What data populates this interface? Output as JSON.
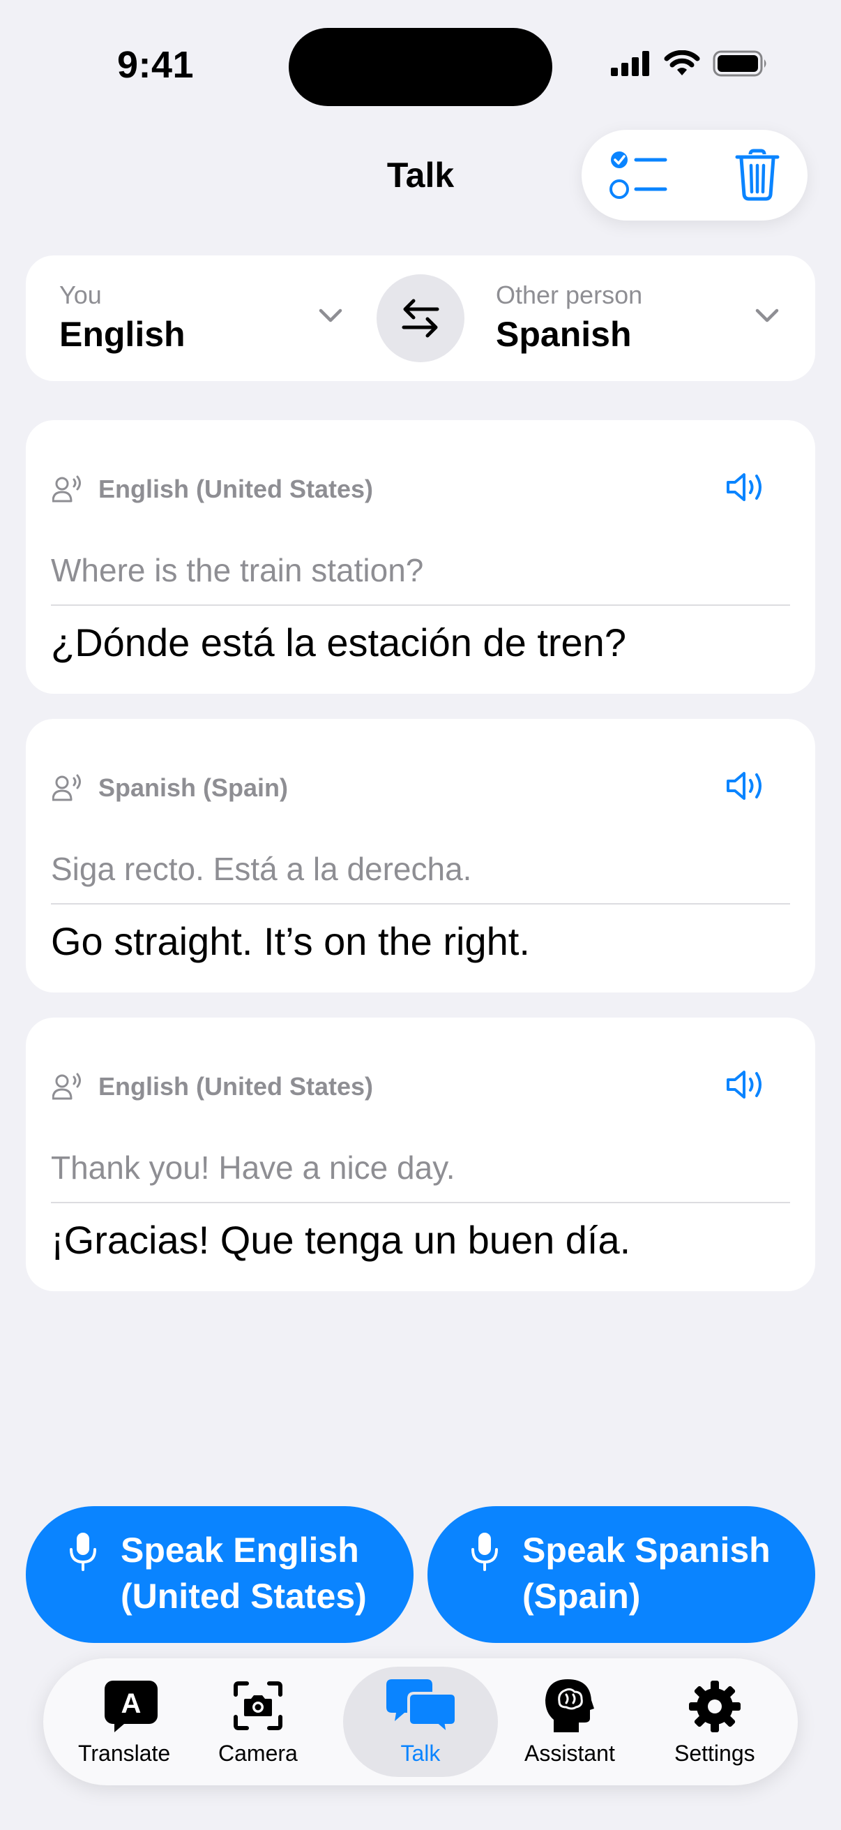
{
  "status_bar": {
    "time": "9:41"
  },
  "header": {
    "title": "Talk"
  },
  "language_selector": {
    "left": {
      "caption": "You",
      "language": "English"
    },
    "right": {
      "caption": "Other person",
      "language": "Spanish"
    }
  },
  "conversation": [
    {
      "language": "English (United States)",
      "source": "Where is the train station?",
      "translation": "¿Dónde está la estación de tren?"
    },
    {
      "language": "Spanish (Spain)",
      "source": "Siga recto. Está a la derecha.",
      "translation": "Go straight. It’s on the right."
    },
    {
      "language": "English (United States)",
      "source": "Thank you! Have a nice day.",
      "translation": "¡Gracias! Que tenga un buen día."
    }
  ],
  "speak_buttons": {
    "left": {
      "line1": "Speak English",
      "line2": "(United States)"
    },
    "right": {
      "line1": "Speak Spanish",
      "line2": "(Spain)"
    }
  },
  "tab_bar": {
    "active": "Talk",
    "tabs": [
      {
        "label": "Translate",
        "icon": "translate-icon"
      },
      {
        "label": "Camera",
        "icon": "camera-icon"
      },
      {
        "label": "Talk",
        "icon": "talk-bubbles-icon"
      },
      {
        "label": "Assistant",
        "icon": "brain-head-icon"
      },
      {
        "label": "Settings",
        "icon": "gear-icon"
      }
    ]
  },
  "colors": {
    "accent": "#0A84FF",
    "background": "#F1F1F6",
    "secondary_text": "#8E8E93"
  }
}
